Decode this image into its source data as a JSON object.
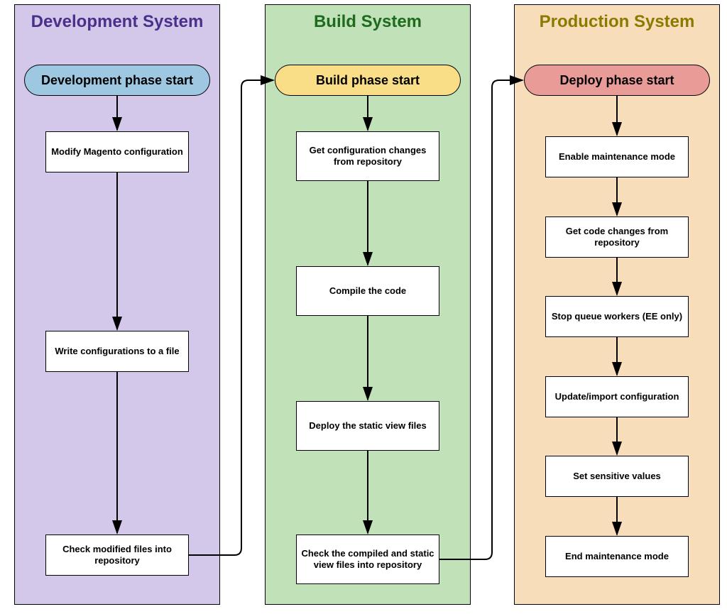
{
  "chart_data": {
    "type": "flowchart",
    "title": "",
    "lanes": [
      {
        "id": "development",
        "title": "Development System",
        "bg": "#D3C8E9",
        "title_color": "#4A2F8B",
        "start": {
          "label": "Development phase start",
          "bg": "#9EC8E2"
        },
        "steps": [
          "Modify Magento configuration",
          "Write configurations to a file",
          "Check modified files into repository"
        ]
      },
      {
        "id": "build",
        "title": "Build System",
        "bg": "#C1E1B9",
        "title_color": "#1E6B1E",
        "start": {
          "label": "Build phase start",
          "bg": "#F9DE87"
        },
        "steps": [
          "Get configuration changes from repository",
          "Compile the code",
          "Deploy the static view files",
          "Check the compiled and static view files into repository"
        ]
      },
      {
        "id": "production",
        "title": "Production System",
        "bg": "#F7DDB9",
        "title_color": "#8A7A00",
        "start": {
          "label": "Deploy phase start",
          "bg": "#E99B98"
        },
        "steps": [
          "Enable maintenance mode",
          "Get code changes from repository",
          "Stop queue workers (EE only)",
          "Update/import configuration",
          "Set sensitive values",
          "End maintenance mode"
        ]
      }
    ],
    "lane_connections": [
      {
        "from_lane": "development",
        "to_lane": "build"
      },
      {
        "from_lane": "build",
        "to_lane": "production"
      }
    ]
  }
}
